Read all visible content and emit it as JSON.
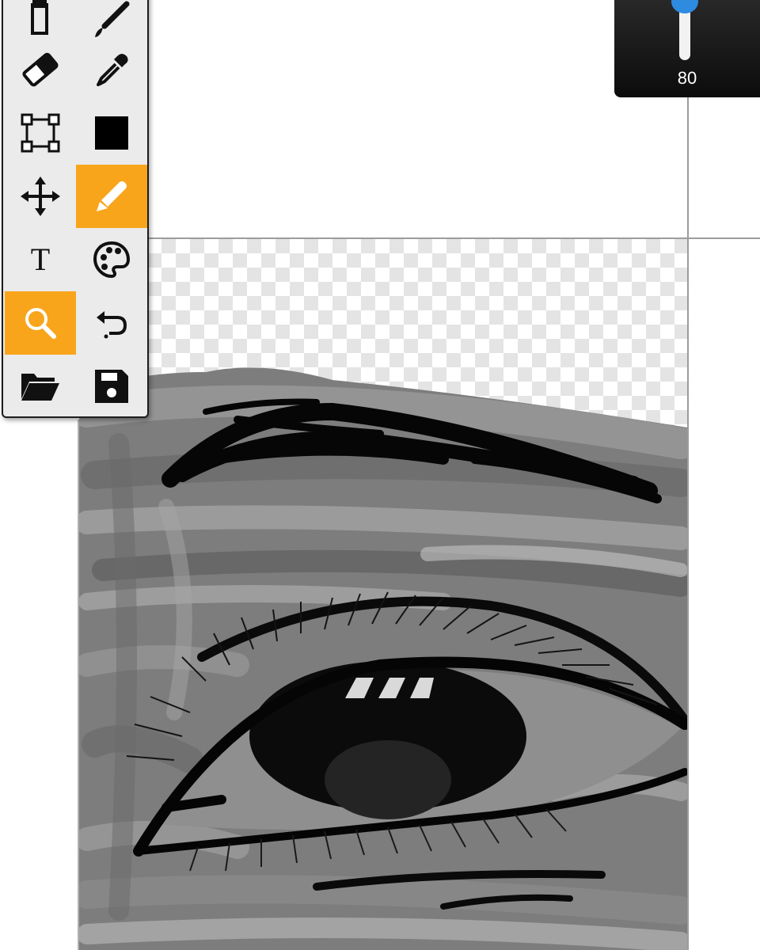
{
  "toolbar": {
    "tools": [
      {
        "id": "pencil",
        "icon": "pencil-icon",
        "active": false
      },
      {
        "id": "brush",
        "icon": "brush-icon",
        "active": false
      },
      {
        "id": "eraser",
        "icon": "eraser-icon",
        "active": false
      },
      {
        "id": "eyedropper",
        "icon": "eyedropper-icon",
        "active": false
      },
      {
        "id": "transform",
        "icon": "transform-icon",
        "active": false
      },
      {
        "id": "color-swatch",
        "icon": "color-swatch-icon",
        "active": false
      },
      {
        "id": "move",
        "icon": "move-icon",
        "active": false
      },
      {
        "id": "marker",
        "icon": "marker-icon",
        "active": true
      },
      {
        "id": "text",
        "icon": "text-icon",
        "label": "T",
        "active": false
      },
      {
        "id": "palette",
        "icon": "palette-icon",
        "active": false
      },
      {
        "id": "zoom",
        "icon": "zoom-icon",
        "active": true
      },
      {
        "id": "undo",
        "icon": "undo-icon",
        "active": false
      },
      {
        "id": "open",
        "icon": "folder-icon",
        "active": false
      },
      {
        "id": "save",
        "icon": "save-icon",
        "active": false
      }
    ],
    "active_color": "#f8a51c",
    "current_color": "#000000"
  },
  "brush_size": {
    "value": "80",
    "level": 0.8,
    "slider_color": "#2e8be0"
  }
}
